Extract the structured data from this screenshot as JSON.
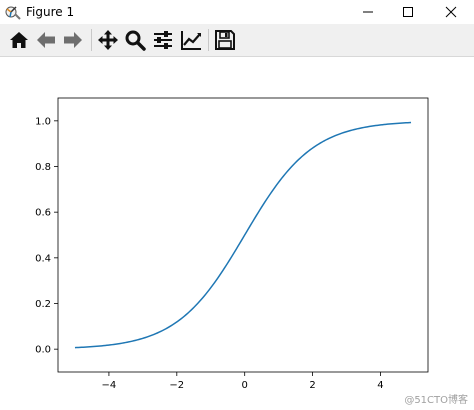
{
  "window": {
    "title": "Figure 1",
    "title_icon": "matplotlib-icon",
    "controls": {
      "minimize_icon": "minimize-icon",
      "maximize_icon": "maximize-icon",
      "close_icon": "close-icon"
    }
  },
  "toolbar": {
    "items": [
      {
        "name": "home-button",
        "icon": "home-icon"
      },
      {
        "name": "back-button",
        "icon": "arrow-left-icon"
      },
      {
        "name": "forward-button",
        "icon": "arrow-right-icon"
      },
      {
        "name": "pan-button",
        "icon": "move-icon"
      },
      {
        "name": "zoom-button",
        "icon": "magnifier-icon"
      },
      {
        "name": "configure-subplots-button",
        "icon": "sliders-icon"
      },
      {
        "name": "edit-axis-button",
        "icon": "line-chart-icon"
      },
      {
        "name": "save-button",
        "icon": "floppy-disk-icon"
      }
    ]
  },
  "watermark": "@51CTO博客",
  "colors": {
    "line": "#1f77b4",
    "toolbar_bg": "#f0f0f0"
  },
  "chart_data": {
    "type": "line",
    "function": "sigmoid",
    "x": [
      -5.0,
      -4.5,
      -4.0,
      -3.5,
      -3.0,
      -2.5,
      -2.0,
      -1.5,
      -1.0,
      -0.5,
      0.0,
      0.5,
      1.0,
      1.5,
      2.0,
      2.5,
      3.0,
      3.5,
      4.0,
      4.5,
      4.9
    ],
    "y": [
      0.0067,
      0.011,
      0.018,
      0.0293,
      0.0474,
      0.0759,
      0.1192,
      0.1824,
      0.2689,
      0.3775,
      0.5,
      0.6225,
      0.7311,
      0.8176,
      0.8808,
      0.9241,
      0.9526,
      0.9707,
      0.982,
      0.989,
      0.9926
    ],
    "xlim": [
      -5.5,
      5.4
    ],
    "ylim": [
      -0.1,
      1.1
    ],
    "xticks": [
      -4,
      -2,
      0,
      2,
      4
    ],
    "xtick_labels": [
      "−4",
      "−2",
      "0",
      "2",
      "4"
    ],
    "yticks": [
      0.0,
      0.2,
      0.4,
      0.6,
      0.8,
      1.0
    ],
    "ytick_labels": [
      "0.0",
      "0.2",
      "0.4",
      "0.6",
      "0.8",
      "1.0"
    ],
    "title": "",
    "xlabel": "",
    "ylabel": "",
    "grid": false
  }
}
